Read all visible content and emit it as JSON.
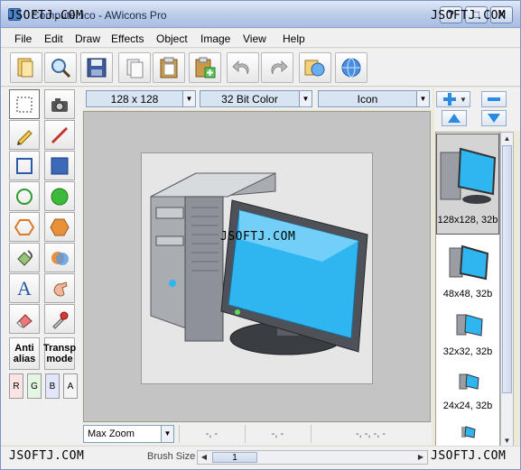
{
  "window": {
    "title": "Computer.ico - AWicons Pro",
    "minimize_glyph": "?",
    "maximize_glyph": "□",
    "close_glyph": "X"
  },
  "menu": [
    "File",
    "Edit",
    "Draw",
    "Effects",
    "Object",
    "Image",
    "View",
    "Help"
  ],
  "toolbar": {
    "buttons": [
      "new-file-icon",
      "zoom-icon",
      "save-icon",
      "copy-icon",
      "paste-icon",
      "paste-new-icon",
      "undo-icon",
      "redo-icon",
      "view-icon",
      "web-icon"
    ]
  },
  "tools": {
    "antialias_label_1": "Anti",
    "antialias_label_2": "alias",
    "transparent_label_1": "Transp",
    "transparent_label_2": "mode",
    "channels": [
      "R",
      "G",
      "B",
      "A"
    ]
  },
  "options": {
    "size": "128 x 128",
    "color_depth": "32 Bit Color",
    "format": "Icon"
  },
  "frames": [
    {
      "label": "128x128, 32b",
      "selected": true
    },
    {
      "label": "48x48, 32b",
      "selected": false
    },
    {
      "label": "32x32, 32b",
      "selected": false
    },
    {
      "label": "24x24, 32b",
      "selected": false
    },
    {
      "label": "",
      "selected": false
    }
  ],
  "status": {
    "zoom": "Max Zoom",
    "coord1": "-, -",
    "coord2": "-, -",
    "coord3": "-, -, -, -",
    "brush_label": "Brush Size",
    "brush_value": "1"
  },
  "watermarks": {
    "text": "JSOFTJ.COM"
  },
  "colors": {
    "selection_gray": "#d4d4d4",
    "combo_blue": "#d9e4f2",
    "canvas_bg": "#c4c4c4",
    "screen_blue": "#2fb6f0"
  }
}
